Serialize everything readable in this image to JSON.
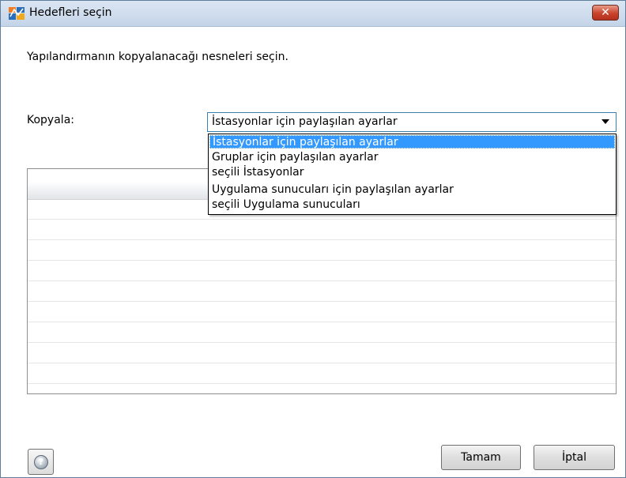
{
  "window": {
    "title": "Hedefleri seçin",
    "close_label": "✕"
  },
  "instruction": "Yapılandırmanın kopyalanacağı nesneleri seçin.",
  "copy": {
    "label": "Kopyala:",
    "selected_value": "İstasyonlar için paylaşılan ayarlar",
    "options": [
      "İstasyonlar için paylaşılan ayarlar",
      "Gruplar için paylaşılan ayarlar",
      "seçili İstasyonlar",
      "Uygulama sunucuları için paylaşılan ayarlar",
      "seçili Uygulama sunucuları"
    ],
    "highlighted_index": 0
  },
  "buttons": {
    "ok": "Tamam",
    "cancel": "İptal",
    "help_icon": "question-mark-icon",
    "help_glyph": "?"
  },
  "colors": {
    "selection": "#3399ff",
    "select_border": "#3c7fb1",
    "close_button": "#c8432b"
  }
}
